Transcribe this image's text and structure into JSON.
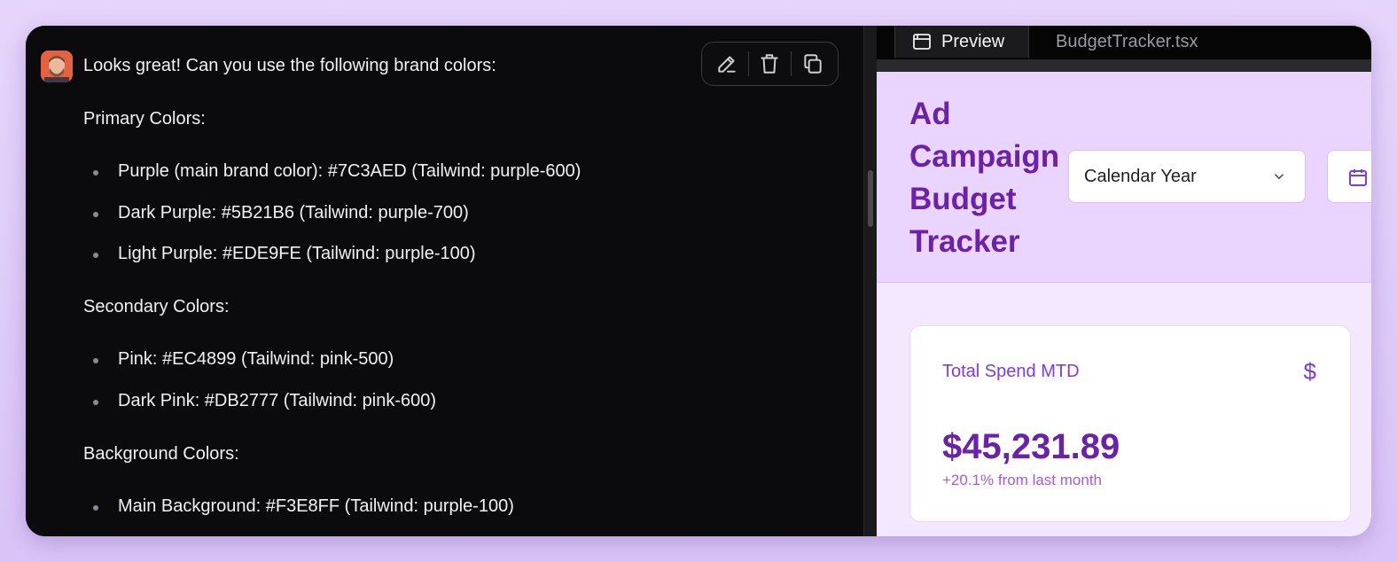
{
  "chat": {
    "user_message": {
      "intro": "Looks great! Can you use the following brand colors:",
      "primary_heading": "Primary Colors:",
      "primary_items": [
        "Purple (main brand color): #7C3AED (Tailwind: purple-600)",
        "Dark Purple: #5B21B6 (Tailwind: purple-700)",
        "Light Purple: #EDE9FE (Tailwind: purple-100)"
      ],
      "secondary_heading": "Secondary Colors:",
      "secondary_items": [
        "Pink: #EC4899 (Tailwind: pink-500)",
        "Dark Pink: #DB2777 (Tailwind: pink-600)"
      ],
      "background_heading": "Background Colors:",
      "background_items": [
        "Main Background: #F3E8FF (Tailwind: purple-100)"
      ]
    },
    "actions": {
      "edit_icon": "pencil-icon",
      "delete_icon": "trash-icon",
      "copy_icon": "copy-icon"
    }
  },
  "preview": {
    "tabs": {
      "preview": "Preview",
      "code": "BudgetTracker.tsx"
    },
    "app": {
      "title": "Ad Campaign Budget Tracker",
      "period_select": "Calendar Year",
      "date_icon": "calendar-icon",
      "card": {
        "title": "Total Spend MTD",
        "icon": "$",
        "value": "$45,231.89",
        "delta": "+20.1% from last month"
      }
    }
  },
  "colors": {
    "brand_purple": "#7C3AED",
    "dark_purple": "#6B21A8",
    "light_purple": "#E9D5FF",
    "background": "#F3E8FF"
  }
}
